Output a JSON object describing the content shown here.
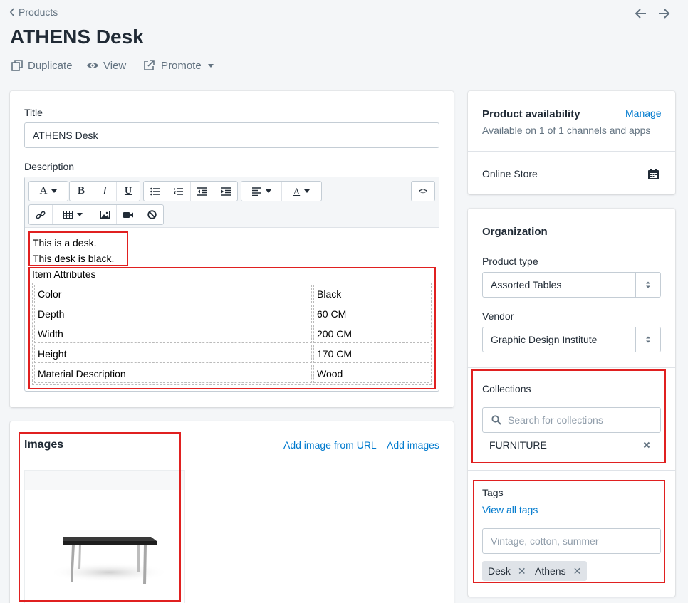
{
  "header": {
    "back_label": "Products",
    "title": "ATHENS Desk",
    "actions": {
      "duplicate": "Duplicate",
      "view": "View",
      "promote": "Promote"
    }
  },
  "product": {
    "title_label": "Title",
    "title_value": "ATHENS Desk",
    "description_label": "Description",
    "toolbar": {
      "font": "A",
      "bold": "B",
      "italic": "I",
      "underline": "U",
      "color": "A",
      "html": "<>"
    },
    "description_lines": [
      "This is a desk.",
      "This desk is black."
    ],
    "attributes_heading": "Item Attributes",
    "attributes": [
      {
        "name": "Color",
        "value": "Black"
      },
      {
        "name": "Depth",
        "value": "60 CM"
      },
      {
        "name": "Width",
        "value": "200 CM"
      },
      {
        "name": "Height",
        "value": "170 CM"
      },
      {
        "name": "Material Description",
        "value": "Wood"
      }
    ]
  },
  "images": {
    "heading": "Images",
    "add_from_url": "Add image from URL",
    "add_images": "Add images"
  },
  "availability": {
    "heading": "Product availability",
    "manage": "Manage",
    "subtitle": "Available on 1 of 1 channels and apps",
    "channel": "Online Store"
  },
  "organization": {
    "heading": "Organization",
    "product_type_label": "Product type",
    "product_type_value": "Assorted Tables",
    "vendor_label": "Vendor",
    "vendor_value": "Graphic Design Institute",
    "collections_label": "Collections",
    "collections_placeholder": "Search for collections",
    "collection_item": "FURNITURE",
    "tags_label": "Tags",
    "view_all_tags": "View all tags",
    "tags_placeholder": "Vintage, cotton, summer",
    "tags": [
      "Desk",
      "Athens"
    ]
  },
  "colors": {
    "link": "#007ace",
    "annotation": "#e02020",
    "background": "#f4f6f8"
  }
}
